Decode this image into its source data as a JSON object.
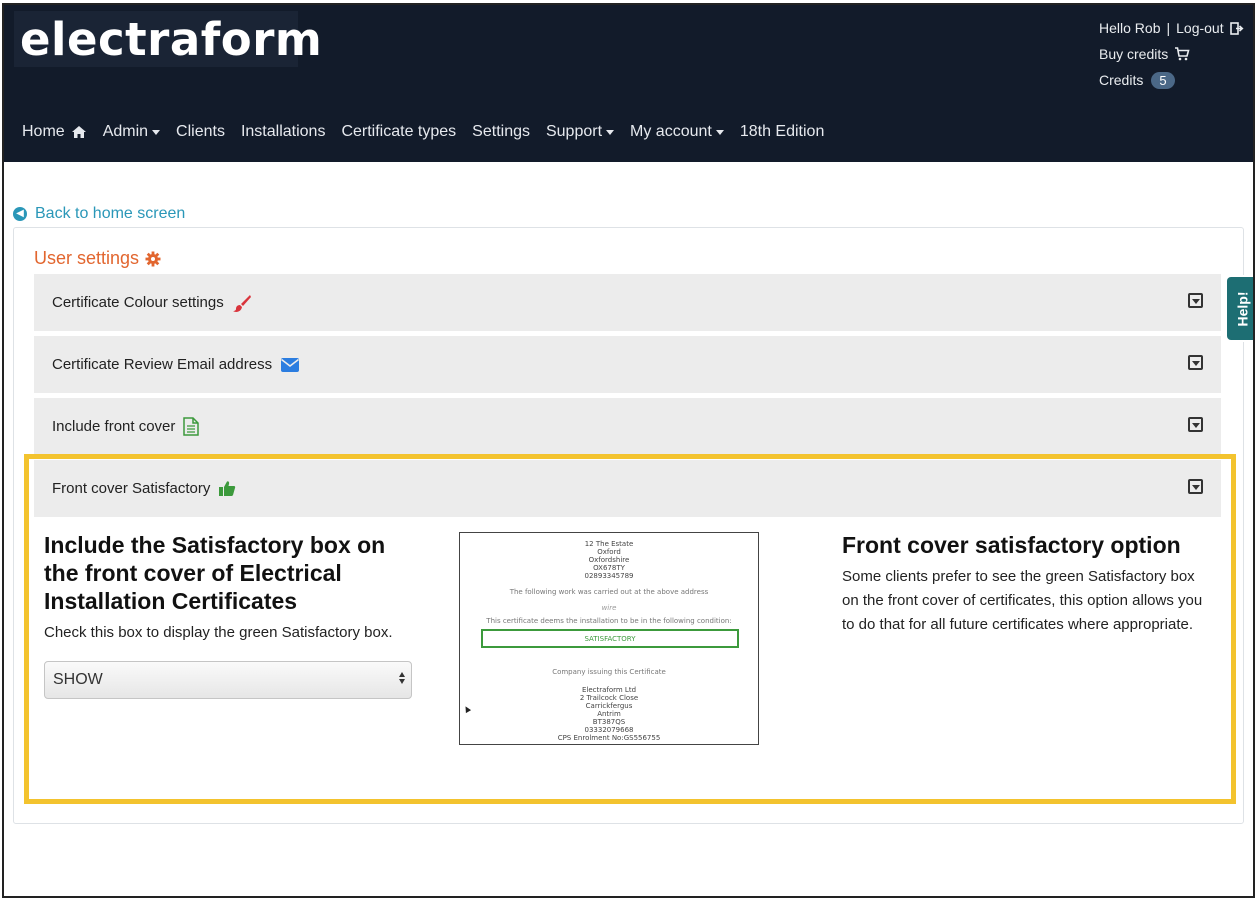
{
  "brand": {
    "logo_text": "electraform"
  },
  "user": {
    "greeting": "Hello Rob",
    "separator": "|",
    "logout": "Log-out",
    "buy_credits": "Buy credits",
    "credits_label": "Credits",
    "credits_count": "5"
  },
  "nav": {
    "home": "Home",
    "admin": "Admin",
    "clients": "Clients",
    "installations": "Installations",
    "certificate_types": "Certificate types",
    "settings": "Settings",
    "support": "Support",
    "my_account": "My account",
    "edition": "18th Edition"
  },
  "back_link": "Back to home screen",
  "settings_title": "User settings",
  "accordion": [
    {
      "label": "Certificate Colour settings",
      "icon": "paint-brush-icon"
    },
    {
      "label": "Certificate Review Email address",
      "icon": "envelope-icon"
    },
    {
      "label": "Include front cover",
      "icon": "document-icon"
    },
    {
      "label": "Front cover Satisfactory",
      "icon": "thumbs-up-icon"
    }
  ],
  "option": {
    "heading": "Include the Satisfactory box on the front cover of Electrical Installation Certificates",
    "help": "Check this box to display the green Satisfactory box.",
    "select_value": "SHOW"
  },
  "preview": {
    "address": [
      "12 The Estate",
      "Oxford",
      "Oxfordshire",
      "OX678TY",
      "02893345789"
    ],
    "work_line": "The following work was carried out at the above address",
    "work_value": "wire",
    "condition_line": "This certificate deems the installation to be in the following condition:",
    "satisfactory": "SATISFACTORY",
    "company_label": "Company issuing this Certificate",
    "company": [
      "Electraform Ltd",
      "2 Trailcock Close",
      "Carrickfergus",
      "Antrim",
      "BT387QS",
      "03332079668",
      "CPS Enrolment No:GS556755"
    ]
  },
  "info": {
    "heading": "Front cover satisfactory option",
    "text": "Some clients prefer to see the green Satisfactory box on the front cover of certificates, this option allows you to do that for all future certificates where appropriate."
  },
  "help_tab": "Help!",
  "colors": {
    "header_bg": "#121b2a",
    "accent_orange": "#e2662f",
    "link_teal": "#2a97b8",
    "highlight_yellow": "#f3c32e",
    "help_tab": "#1d6e73",
    "satisfactory_green": "#3c9a3c"
  }
}
